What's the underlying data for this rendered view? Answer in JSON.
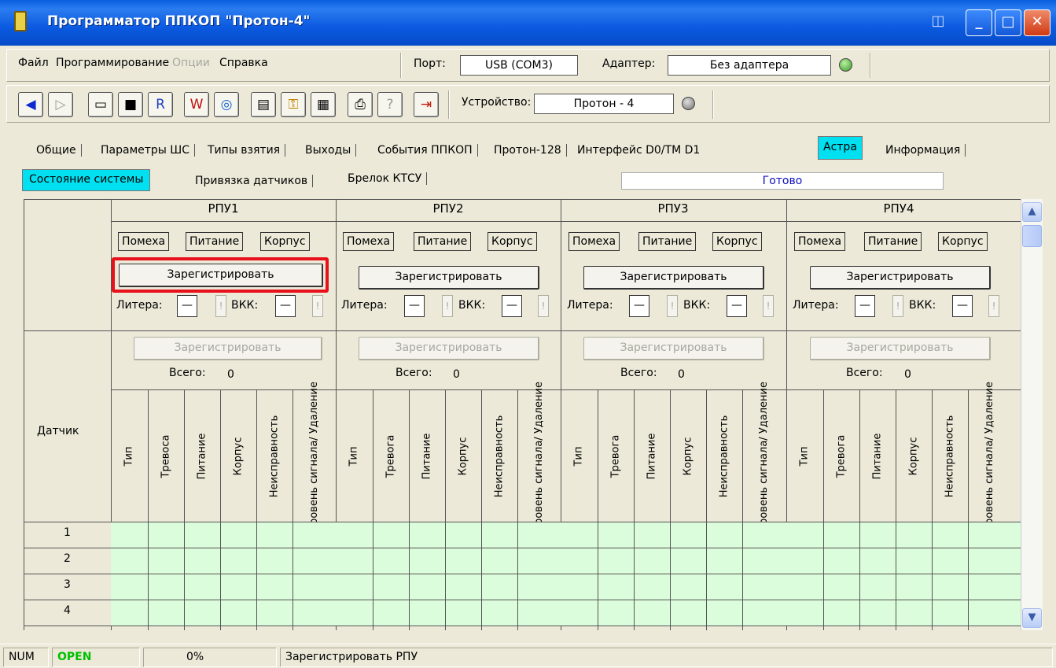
{
  "window": {
    "title": "Программатор ППКОП \"Протон-4\""
  },
  "menu": {
    "items": [
      "Файл",
      "Программирование",
      "Опции",
      "Справка"
    ],
    "port_label": "Порт:",
    "port_value": "USB (COM3)",
    "adapter_label": "Адаптер:",
    "adapter_value": "Без адаптера"
  },
  "toolbar": {
    "device_label": "Устройство:",
    "device_value": "Протон - 4"
  },
  "tabs": [
    "Общие",
    "Параметры ШС",
    "Типы взятия",
    "Выходы",
    "События ППКОП",
    "Протон-128",
    "Интерфейс D0/TM D1",
    "Астра",
    "Информация"
  ],
  "subtabs": [
    "Состояние системы",
    "Привязка датчиков",
    "Брелок КТСУ"
  ],
  "status_message": "Готово",
  "rpu": [
    {
      "title": "РПУ1"
    },
    {
      "title": "РПУ2"
    },
    {
      "title": "РПУ3"
    },
    {
      "title": "РПУ4"
    }
  ],
  "rpu_labels": {
    "noise": "Помеха",
    "power": "Питание",
    "case": "Корпус",
    "register": "Зарегистрировать",
    "litera": "Литера:",
    "vkk": "ВКК:",
    "dash": "—",
    "excl": "!",
    "total_label": "Всего:",
    "total_value": "0"
  },
  "sensor_header": "Датчик",
  "columns": [
    "Тип",
    "Тревога",
    "Питание",
    "Корпус",
    "Неисправность",
    "Уровень сигнала/ Удаление"
  ],
  "columns_rpu1_alarm": "Тревоса",
  "rows": [
    "1",
    "2",
    "3",
    "4"
  ],
  "statusbar": {
    "num": "NUM",
    "open": "OPEN",
    "percent": "0%",
    "message": "Зарегистрировать РПУ"
  },
  "colors": {
    "open_text": "#00c000",
    "active_tab": "#00e0f0",
    "grid_fill": "#dcfddc",
    "highlight": "#e8101a"
  }
}
